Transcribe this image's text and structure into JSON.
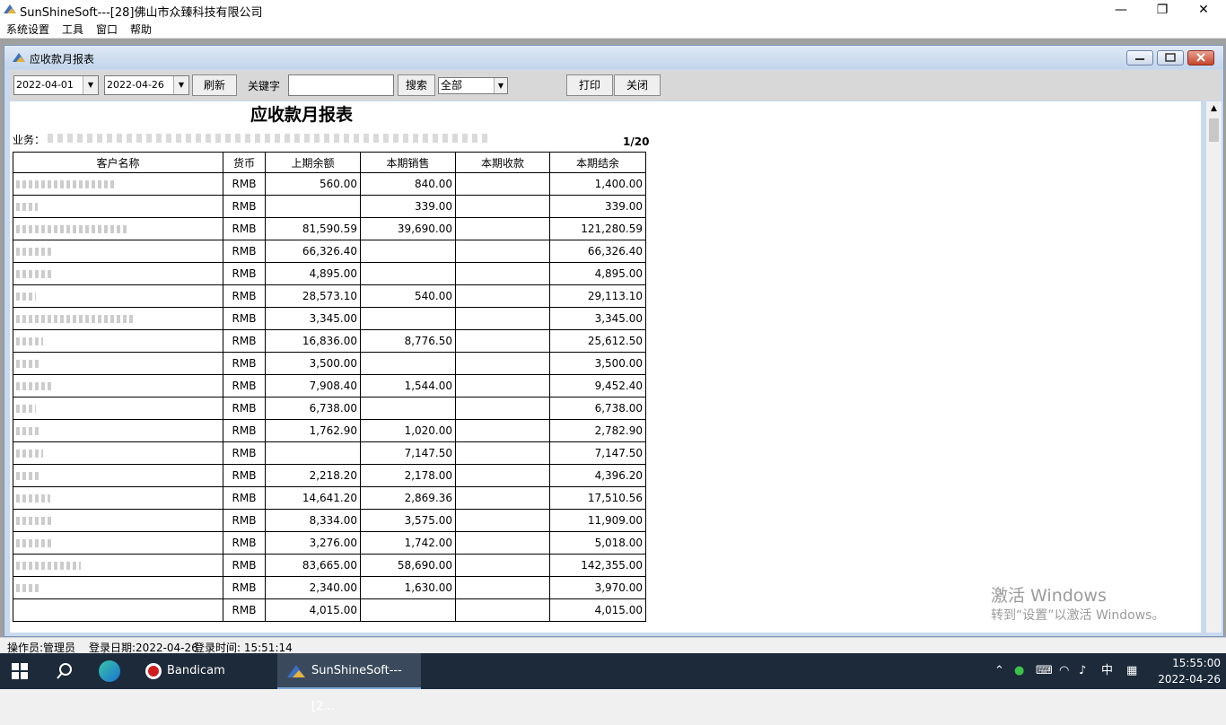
{
  "window": {
    "title": "SunShineSoft---[28]佛山市众臻科技有限公司",
    "minimize": "—",
    "restore": "❐",
    "close": "✕"
  },
  "menu": [
    "系统设置",
    "工具",
    "窗口",
    "帮助"
  ],
  "child": {
    "title": "应收款月报表"
  },
  "toolbar": {
    "date_from": "2022-04-01",
    "date_to": "2022-04-26",
    "refresh": "刷新",
    "keyword_label": "关键字",
    "keyword_value": "",
    "search": "搜索",
    "filter": "全部",
    "print": "打印",
    "close": "关闭"
  },
  "report": {
    "title": "应收款月报表",
    "biz_label": "业务：",
    "page": "1/20",
    "columns": [
      "客户名称",
      "货币",
      "上期余额",
      "本期销售",
      "本期收款",
      "本期结余"
    ],
    "rows": [
      {
        "currency": "RMB",
        "prev": "560.00",
        "sales": "840.00",
        "recv": "",
        "bal": "1,400.00"
      },
      {
        "currency": "RMB",
        "prev": "",
        "sales": "339.00",
        "recv": "",
        "bal": "339.00"
      },
      {
        "currency": "RMB",
        "prev": "81,590.59",
        "sales": "39,690.00",
        "recv": "",
        "bal": "121,280.59"
      },
      {
        "currency": "RMB",
        "prev": "66,326.40",
        "sales": "",
        "recv": "",
        "bal": "66,326.40"
      },
      {
        "currency": "RMB",
        "prev": "4,895.00",
        "sales": "",
        "recv": "",
        "bal": "4,895.00"
      },
      {
        "currency": "RMB",
        "prev": "28,573.10",
        "sales": "540.00",
        "recv": "",
        "bal": "29,113.10"
      },
      {
        "currency": "RMB",
        "prev": "3,345.00",
        "sales": "",
        "recv": "",
        "bal": "3,345.00"
      },
      {
        "currency": "RMB",
        "prev": "16,836.00",
        "sales": "8,776.50",
        "recv": "",
        "bal": "25,612.50"
      },
      {
        "currency": "RMB",
        "prev": "3,500.00",
        "sales": "",
        "recv": "",
        "bal": "3,500.00"
      },
      {
        "currency": "RMB",
        "prev": "7,908.40",
        "sales": "1,544.00",
        "recv": "",
        "bal": "9,452.40"
      },
      {
        "currency": "RMB",
        "prev": "6,738.00",
        "sales": "",
        "recv": "",
        "bal": "6,738.00"
      },
      {
        "currency": "RMB",
        "prev": "1,762.90",
        "sales": "1,020.00",
        "recv": "",
        "bal": "2,782.90"
      },
      {
        "currency": "RMB",
        "prev": "",
        "sales": "7,147.50",
        "recv": "",
        "bal": "7,147.50"
      },
      {
        "currency": "RMB",
        "prev": "2,218.20",
        "sales": "2,178.00",
        "recv": "",
        "bal": "4,396.20"
      },
      {
        "currency": "RMB",
        "prev": "14,641.20",
        "sales": "2,869.36",
        "recv": "",
        "bal": "17,510.56"
      },
      {
        "currency": "RMB",
        "prev": "8,334.00",
        "sales": "3,575.00",
        "recv": "",
        "bal": "11,909.00"
      },
      {
        "currency": "RMB",
        "prev": "3,276.00",
        "sales": "1,742.00",
        "recv": "",
        "bal": "5,018.00"
      },
      {
        "currency": "RMB",
        "prev": "83,665.00",
        "sales": "58,690.00",
        "recv": "",
        "bal": "142,355.00"
      },
      {
        "currency": "RMB",
        "prev": "2,340.00",
        "sales": "1,630.00",
        "recv": "",
        "bal": "3,970.00"
      },
      {
        "currency": "RMB",
        "prev": "4,015.00",
        "sales": "",
        "recv": "",
        "bal": "4,015.00"
      }
    ]
  },
  "watermark": {
    "line1": "激活 Windows",
    "line2": "转到“设置”以激活 Windows。"
  },
  "status": {
    "operator": "操作员:管理员",
    "login_date": "登录日期:2022-04-26",
    "login_time": "登录时间: 15:51:14"
  },
  "taskbar": {
    "bandicam": "Bandicam",
    "sunshine": "SunShineSoft---[2...",
    "ime": "中",
    "time": "15:55:00",
    "date": "2022-04-26"
  }
}
